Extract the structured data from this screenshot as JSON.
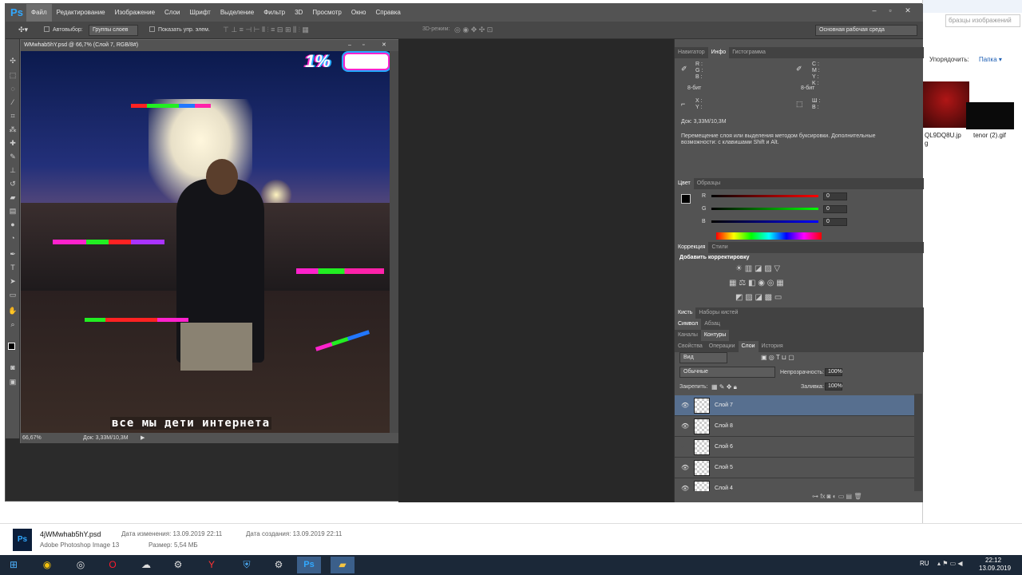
{
  "explorer": {
    "search_placeholder": "бразцы изображений",
    "sort_label": "Упорядочить:",
    "folder_label": "Папка ▾",
    "files": [
      {
        "name": "QL9DQ8U.jp\ng"
      },
      {
        "name": "tenor (2).gif"
      }
    ]
  },
  "ps": {
    "logo": "Ps",
    "menus": [
      "Файл",
      "Редактирование",
      "Изображение",
      "Слои",
      "Шрифт",
      "Выделение",
      "Фильтр",
      "3D",
      "Просмотр",
      "Окно",
      "Справка"
    ],
    "options": {
      "autoselect": "Автовыбор:",
      "group_select": "Группы слоев",
      "show_transform": "Показать упр. элем.",
      "mode3d": "3D-режим:",
      "workspace": "Основная рабочая среда"
    },
    "document": {
      "tab_title": "WMwhab5hY.psd @ 66,7% (Слой 7, RGB/8#)",
      "zoom": "66,67%",
      "doc_size": "Док: 3,33M/10,3M",
      "overlay_top": "1%",
      "caption": "все мы дети интернета"
    },
    "panels": {
      "info_tabs": [
        "Навигатор",
        "Инфо",
        "Гистограмма"
      ],
      "info": {
        "rgb": "R :\nG :\nB :",
        "bit1": "8-бит",
        "cmyk": "C :\nM :\nY :\nK :",
        "bit2": "8-бит",
        "xy": "X :\nY :",
        "wh": "Ш :\nВ :",
        "doc": "Док: 3,33M/10,3M",
        "help": "Перемещение слоя или выделения методом буксировки. Дополнительные\nвозможности: с клавишами Shift и Alt."
      },
      "color_tabs": [
        "Цвет",
        "Образцы"
      ],
      "color": {
        "r_label": "R",
        "g_label": "G",
        "b_label": "B",
        "r": "0",
        "g": "0",
        "b": "0"
      },
      "adj_tabs": [
        "Коррекция",
        "Стили"
      ],
      "adj_title": "Добавить корректировку",
      "brush_tabs": [
        "Кисть",
        "Наборы кистей"
      ],
      "char_tabs": [
        "Символ",
        "Абзац"
      ],
      "chan_tabs": [
        "Каналы",
        "Контуры"
      ],
      "layers_tabs": [
        "Свойства",
        "Операции",
        "Слои",
        "История"
      ],
      "layers": {
        "filter": "Вид",
        "blend": "Обычные",
        "opacity_label": "Непрозрачность:",
        "opacity": "100%",
        "lock_label": "Закрепить:",
        "fill_label": "Заливка:",
        "fill": "100%",
        "items": [
          {
            "name": "Слой 7",
            "visible": true,
            "selected": true
          },
          {
            "name": "Слой 8",
            "visible": true,
            "selected": false
          },
          {
            "name": "Слой 6",
            "visible": false,
            "selected": false
          },
          {
            "name": "Слой 5",
            "visible": true,
            "selected": false
          },
          {
            "name": "Слой 4",
            "visible": true,
            "selected": false
          }
        ]
      }
    }
  },
  "statusbar": {
    "filename": "4jWMwhab5hY.psd",
    "filetype": "Adobe Photoshop Image 13",
    "modified_label": "Дата изменения: 13.09.2019 22:11",
    "size_label": "Размер: 5,54 МБ",
    "created_label": "Дата создания: 13.09.2019 22:11"
  },
  "taskbar": {
    "lang": "RU",
    "time": "22:12",
    "date": "13.09.2019"
  },
  "colors": {
    "accent": "#31a8ff",
    "selected_layer": "#576f8f"
  }
}
